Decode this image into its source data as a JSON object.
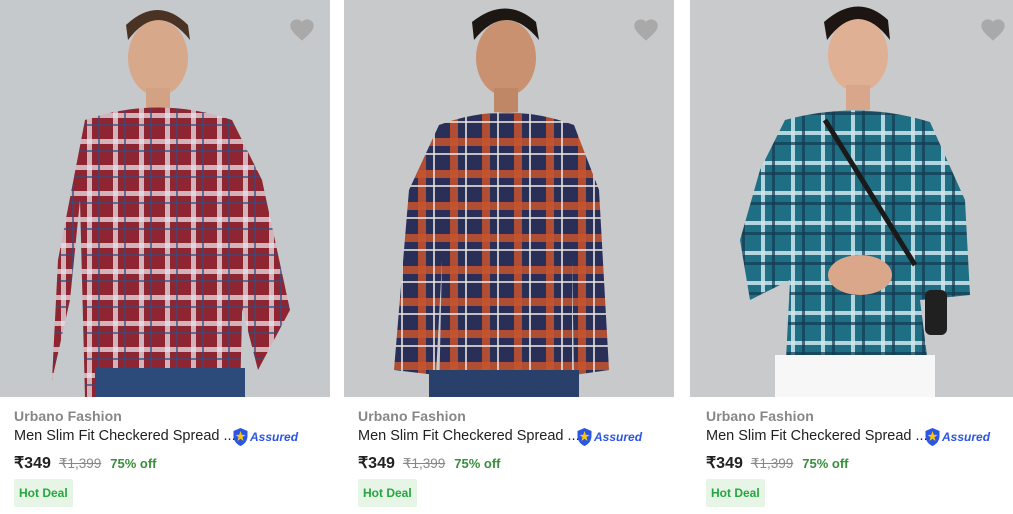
{
  "products": [
    {
      "brand": "Urbano Fashion",
      "title": "Men Slim Fit Checkered Spread ...",
      "assured_label": "Assured",
      "price": "₹349",
      "mrp": "₹1,399",
      "discount": "75% off",
      "badge": "Hot Deal",
      "shirt_color": "#8e2530",
      "check_color": "#e7e2ea"
    },
    {
      "brand": "Urbano Fashion",
      "title": "Men Slim Fit Checkered Spread ...",
      "assured_label": "Assured",
      "price": "₹349",
      "mrp": "₹1,399",
      "discount": "75% off",
      "badge": "Hot Deal",
      "shirt_color": "#2a2f5a",
      "check_color": "#c7542d"
    },
    {
      "brand": "Urbano Fashion",
      "title": "Men Slim Fit Checkered Spread ...",
      "assured_label": "Assured",
      "price": "₹349",
      "mrp": "₹1,399",
      "discount": "75% off",
      "badge": "Hot Deal",
      "shirt_color": "#1e6f84",
      "check_color": "#cfe6ee"
    }
  ],
  "icons": {
    "wishlist": "heart-icon",
    "assured": "shield-icon"
  },
  "colors": {
    "image_bg": "#c9cbcc",
    "discount": "#388e3c",
    "badge_bg": "#e6f5e6",
    "badge_text": "#26a541",
    "assured": "#2a55e5"
  }
}
